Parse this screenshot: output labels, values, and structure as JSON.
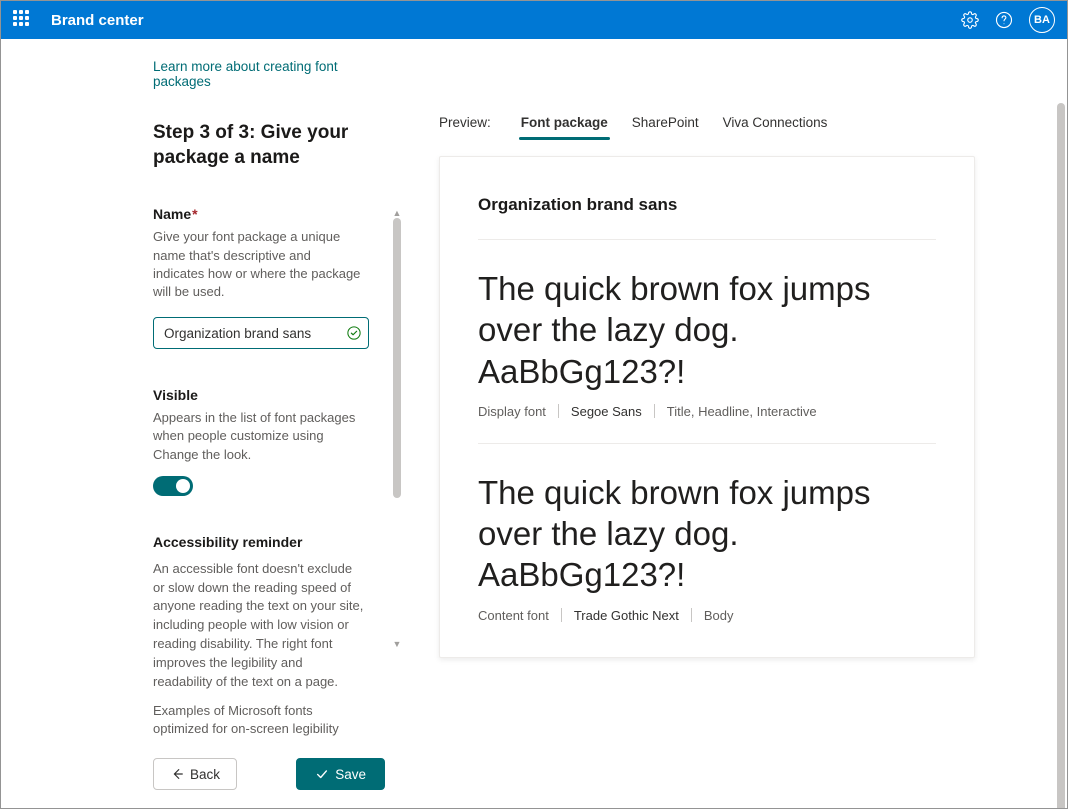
{
  "header": {
    "title": "Brand center",
    "avatar": "BA"
  },
  "left": {
    "learn_link": "Learn more about creating font packages",
    "step_heading": "Step 3 of 3: Give your package a name",
    "name_label": "Name",
    "name_help": "Give your font package a unique name that's descriptive and indicates how or where the package will be used.",
    "name_value": "Organization brand sans",
    "visible_label": "Visible",
    "visible_help": "Appears in the list of font packages when people customize using Change the look.",
    "access_label": "Accessibility reminder",
    "access_p1": "An accessible font doesn't exclude or slow down the reading speed of anyone reading the text on your site, including people with low vision or reading disability. The right font improves the legibility and readability of the text on a page.",
    "access_p2": "Examples of Microsoft fonts optimized for on-screen legibility include Segoe UI, Calibri, Sitka, Cambria and the Aptos family.",
    "back_label": "Back",
    "save_label": "Save"
  },
  "tabs": {
    "preview_label": "Preview:",
    "items": [
      "Font package",
      "SharePoint",
      "Viva Connections"
    ],
    "active": 0
  },
  "preview": {
    "pkg_name": "Organization brand sans",
    "sample": "The quick brown fox jumps over the lazy dog. AaBbGg123?!",
    "display": {
      "role": "Display font",
      "family": "Segoe Sans",
      "usage": "Title, Headline, Interactive"
    },
    "content": {
      "role": "Content font",
      "family": "Trade Gothic Next",
      "usage": "Body"
    }
  }
}
